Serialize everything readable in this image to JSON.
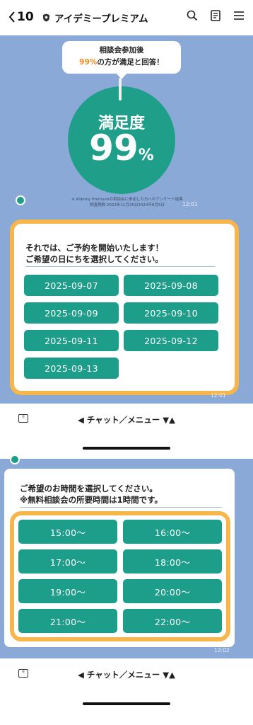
{
  "header": {
    "back_label": "10",
    "title": "アイデミープレミアム"
  },
  "promo": {
    "speech_line1": "相談会参加後",
    "speech_pct": "99%",
    "speech_line2": "の方が満足と回答！",
    "gauge_label": "満足度",
    "gauge_value": "99",
    "gauge_unit": "%",
    "note_line1": "※ Aidemy Premiumの相談会に参加した方へのアンケート結果",
    "note_line2": "調査期間 2023年11月25日2024年6月5日",
    "time": "12:01"
  },
  "date_card": {
    "line1": "それでは、ご予約を開始いたします！",
    "line2": "ご希望の日にちを選択してください。",
    "dates": [
      "2025-09-07",
      "2025-09-08",
      "2025-09-09",
      "2025-09-10",
      "2025-09-11",
      "2025-09-12",
      "2025-09-13"
    ],
    "time": "12:01"
  },
  "time_card": {
    "line1": "ご希望のお時間を選択してください。",
    "line2": "※無料相談会の所要時間は1時間です。",
    "times": [
      "15:00～",
      "16:00～",
      "17:00～",
      "18:00～",
      "19:00～",
      "20:00～",
      "21:00～",
      "22:00～"
    ],
    "time": "12:02"
  },
  "bottom_bar": {
    "label": "◀ チャット／メニュー ▼▲"
  },
  "colors": {
    "chat_bg": "#8aa9d6",
    "accent_teal": "#1d9e8a",
    "highlight_orange": "#f7b64b"
  }
}
